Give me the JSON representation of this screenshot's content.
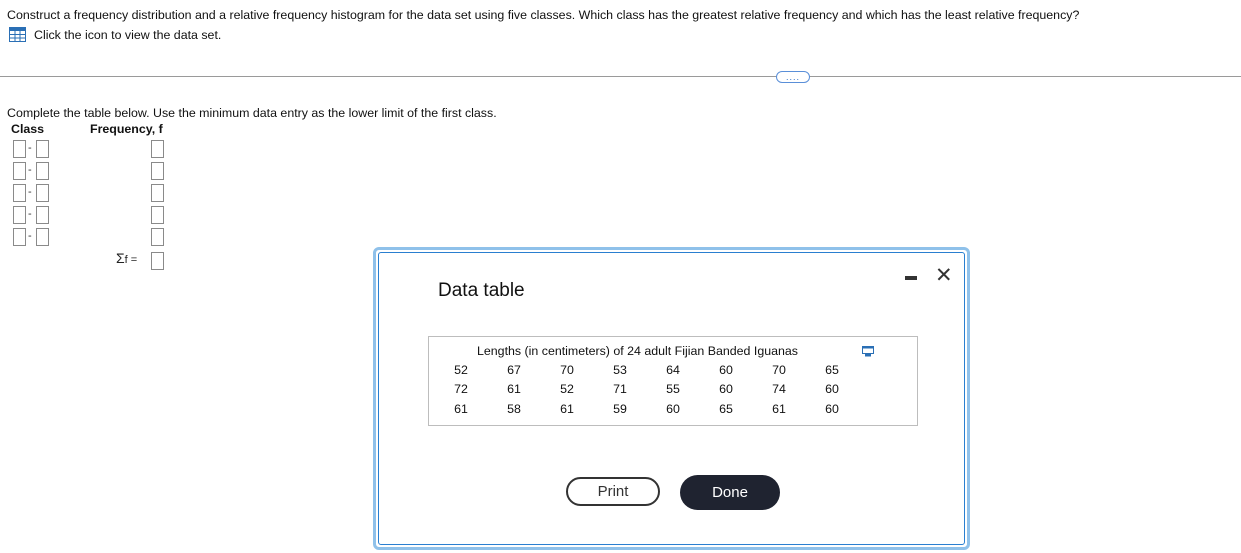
{
  "question": "Construct a frequency distribution and a relative frequency histogram for the data set using five classes. Which class has the greatest relative frequency and which has the least relative frequency?",
  "dataset_link": {
    "label": "Click the icon to view the data set.",
    "icon": "grid-table-icon"
  },
  "more_button": "....",
  "instructions": "Complete the table below. Use the minimum data entry as the lower limit of the first class.",
  "table": {
    "class_header": "Class",
    "frequency_header": "Frequency, f",
    "rows": [
      {
        "lower": "",
        "separator": "-",
        "upper": "",
        "frequency": ""
      },
      {
        "lower": "",
        "separator": "-",
        "upper": "",
        "frequency": ""
      },
      {
        "lower": "",
        "separator": "-",
        "upper": "",
        "frequency": ""
      },
      {
        "lower": "",
        "separator": "-",
        "upper": "",
        "frequency": ""
      },
      {
        "lower": "",
        "separator": "-",
        "upper": "",
        "frequency": ""
      }
    ],
    "sum_label_sigma": "Σ",
    "sum_label": "f =",
    "sum_value": ""
  },
  "modal": {
    "title": "Data table",
    "caption": "Lengths (in centimeters) of 24 adult Fijian Banded Iguanas",
    "values": [
      [
        "52",
        "67",
        "70",
        "53",
        "64",
        "60",
        "70",
        "65"
      ],
      [
        "72",
        "61",
        "52",
        "71",
        "55",
        "60",
        "74",
        "60"
      ],
      [
        "61",
        "58",
        "61",
        "59",
        "60",
        "65",
        "61",
        "60"
      ]
    ],
    "print_label": "Print",
    "done_label": "Done",
    "close_glyph": "✕",
    "colors": {
      "frame": "#8fc1ea",
      "frame_inner": "#2a7fd0",
      "done_bg": "#1f2330"
    }
  }
}
